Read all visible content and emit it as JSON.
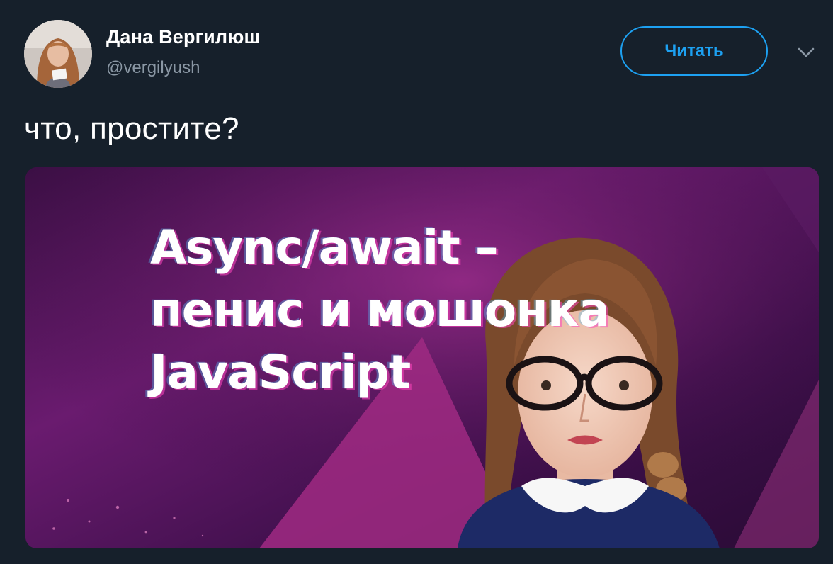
{
  "author": {
    "name": "Дана Вергилюш",
    "handle": "@vergilyush"
  },
  "actions": {
    "follow_label": "Читать"
  },
  "tweet": {
    "text": "что, простите?"
  },
  "media": {
    "headline_lines": [
      "Async/await –",
      "пенис и мошонка",
      "JavaScript"
    ]
  },
  "colors": {
    "background": "#16202b",
    "accent": "#1da1f2",
    "secondary_text": "#8b98a5"
  },
  "icons": {
    "menu": "chevron-down-icon"
  }
}
